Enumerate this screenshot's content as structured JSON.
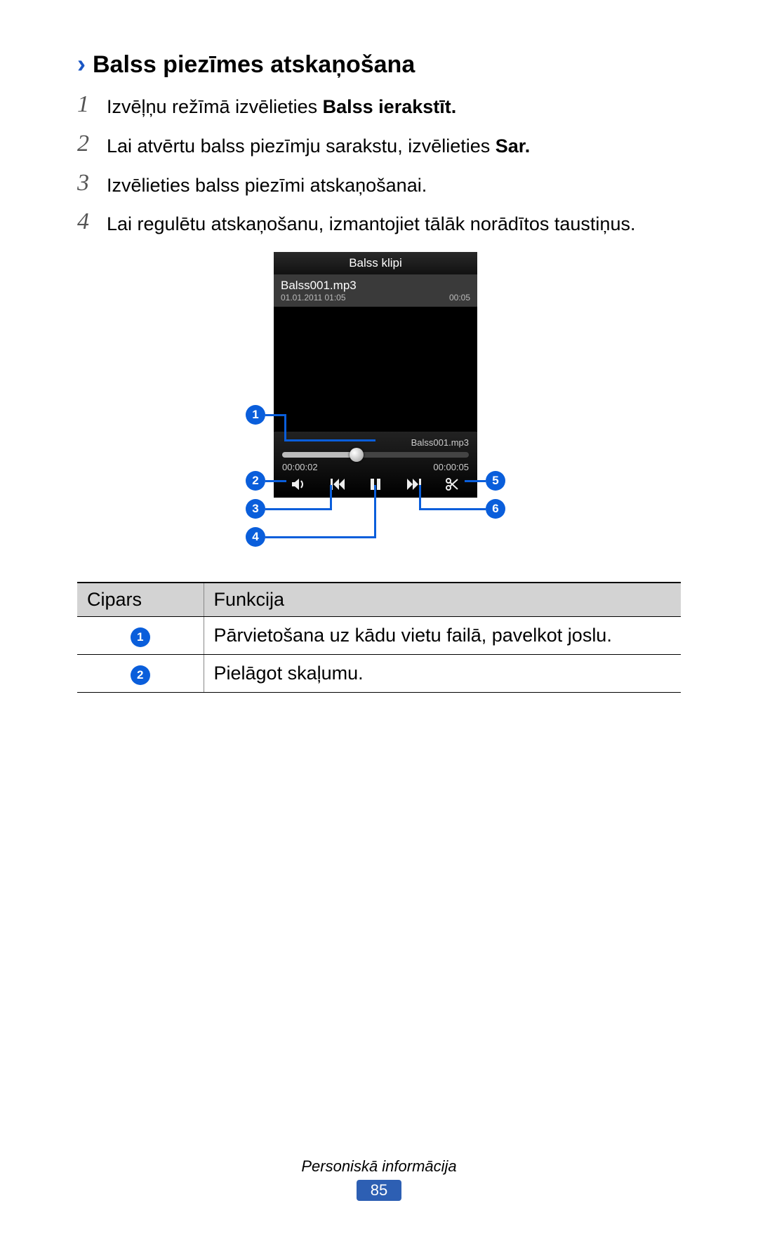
{
  "heading": "Balss piezīmes atskaņošana",
  "steps": [
    {
      "num": "1",
      "pre": "Izvēļņu režīmā izvēlieties ",
      "bold": "Balss ierakstīt.",
      "post": ""
    },
    {
      "num": "2",
      "pre": "Lai atvērtu balss piezīmju sarakstu, izvēlieties ",
      "bold": "Sar.",
      "post": ""
    },
    {
      "num": "3",
      "pre": "Izvēlieties balss piezīmi atskaņošanai.",
      "bold": "",
      "post": ""
    },
    {
      "num": "4",
      "pre": "Lai regulētu atskaņošanu, izmantojiet tālāk norādītos taustiņus.",
      "bold": "",
      "post": ""
    }
  ],
  "phone": {
    "title": "Balss klipi",
    "file_name": "Balss001.mp3",
    "file_date": "01.01.2011 01:05",
    "file_dur": "00:05",
    "now_playing": "Balss001.mp3",
    "time_elapsed": "00:00:02",
    "time_total": "00:00:05"
  },
  "callouts": {
    "b1": "1",
    "b2": "2",
    "b3": "3",
    "b4": "4",
    "b5": "5",
    "b6": "6"
  },
  "table": {
    "head_num": "Cipars",
    "head_func": "Funkcija",
    "rows": [
      {
        "badge": "1",
        "func": "Pārvietošana uz kādu vietu failā, pavelkot joslu."
      },
      {
        "badge": "2",
        "func": "Pielāgot skaļumu."
      }
    ]
  },
  "footer": {
    "section": "Personiskā informācija",
    "page": "85"
  }
}
